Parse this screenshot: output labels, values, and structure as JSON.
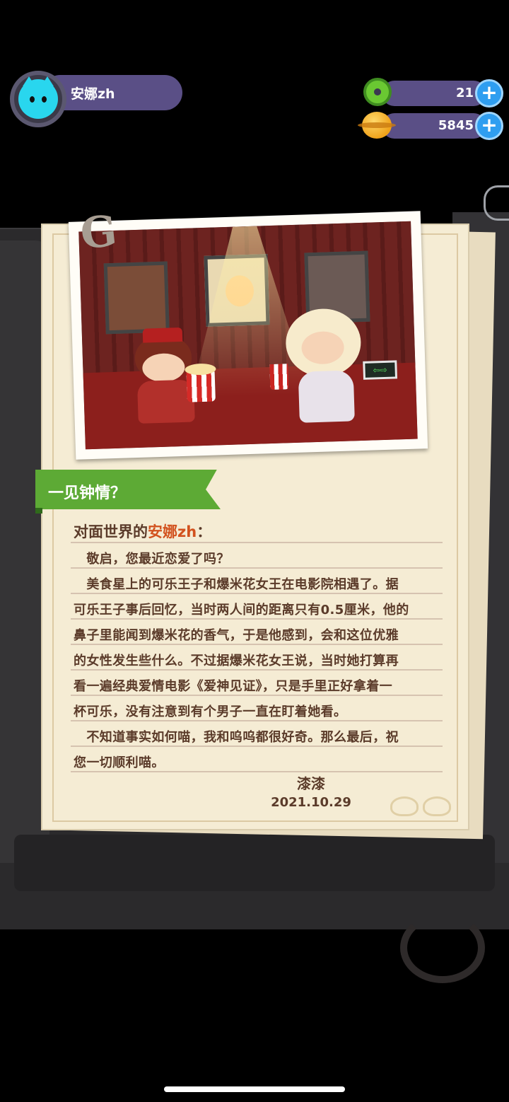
{
  "player": {
    "name": "安娜zh"
  },
  "currencies": [
    {
      "icon": "donut-icon",
      "value": "21"
    },
    {
      "icon": "planet-coin-icon",
      "value": "5845"
    }
  ],
  "plus_symbol": "+",
  "letter": {
    "chapter_mark": "G",
    "title": "一见钟情？",
    "greeting_prefix": "对面世界的",
    "greeting_name": "安娜zh",
    "greeting_suffix": "：",
    "lines": [
      "　敬启，您最近恋爱了吗？",
      "　美食星上的可乐王子和爆米花女王在电影院相遇了。据",
      "可乐王子事后回忆，当时两人间的距离只有0.5厘米，他的",
      "鼻子里能闻到爆米花的香气，于是他感到，会和这位优雅",
      "的女性发生些什么。不过据爆米花女王说，当时她打算再",
      "看一遍经典爱情电影《爱神见证》，只是手里正好拿着一",
      "杯可乐，没有注意到有个男子一直在盯着她看。",
      "　不知道事实如何喵，我和呜呜都很好奇。那么最后，祝",
      "您一切顺利喵。"
    ],
    "signature": "漆漆",
    "date": "2021.10.29"
  },
  "photo": {
    "exit_sign": "⇦⇨"
  },
  "colors": {
    "accent_green": "#5daa35",
    "name_highlight": "#d2521e",
    "text_brown": "#5b3b2a"
  }
}
